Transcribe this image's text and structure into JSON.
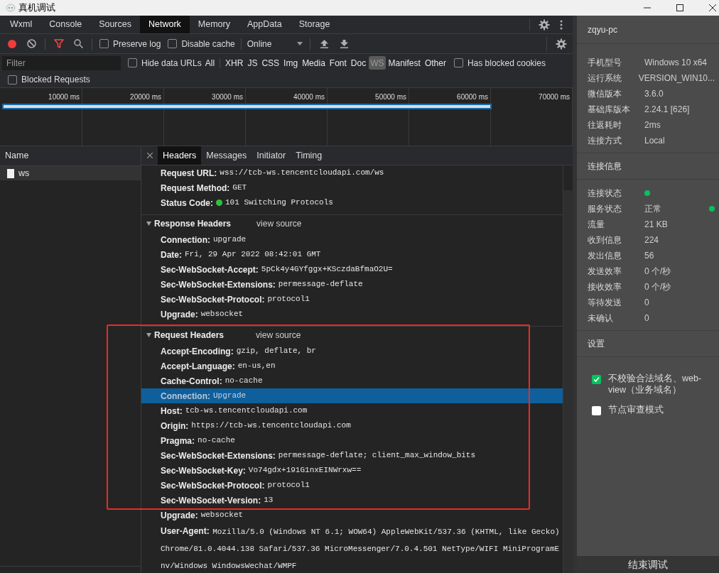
{
  "window": {
    "title": "真机调试"
  },
  "tabs": [
    {
      "label": "Wxml",
      "selected": false
    },
    {
      "label": "Console",
      "selected": false
    },
    {
      "label": "Sources",
      "selected": false
    },
    {
      "label": "Network",
      "selected": true
    },
    {
      "label": "Memory",
      "selected": false
    },
    {
      "label": "AppData",
      "selected": false
    },
    {
      "label": "Storage",
      "selected": false
    }
  ],
  "toolbar": {
    "recording": true,
    "preserve_log": {
      "label": "Preserve log",
      "checked": false
    },
    "disable_cache": {
      "label": "Disable cache",
      "checked": false
    },
    "throttling": "Online"
  },
  "filter": {
    "placeholder": "Filter",
    "hide_data_urls": {
      "label": "Hide data URLs",
      "checked": false
    },
    "types": [
      {
        "label": "All",
        "selected": false
      },
      {
        "label": "XHR",
        "selected": false
      },
      {
        "label": "JS",
        "selected": false
      },
      {
        "label": "CSS",
        "selected": false
      },
      {
        "label": "Img",
        "selected": false
      },
      {
        "label": "Media",
        "selected": false
      },
      {
        "label": "Font",
        "selected": false
      },
      {
        "label": "Doc",
        "selected": false
      },
      {
        "label": "WS",
        "selected": true
      },
      {
        "label": "Manifest",
        "selected": false
      },
      {
        "label": "Other",
        "selected": false
      }
    ],
    "has_blocked_cookies": {
      "label": "Has blocked cookies",
      "checked": false
    },
    "blocked_requests": {
      "label": "Blocked Requests",
      "checked": false
    }
  },
  "timeline": {
    "ticks": [
      "10000 ms",
      "20000 ms",
      "30000 ms",
      "40000 ms",
      "50000 ms",
      "60000 ms",
      "70000 ms"
    ]
  },
  "requests": {
    "header": "Name",
    "items": [
      {
        "name": "ws",
        "selected": true
      }
    ]
  },
  "detail_tabs": [
    {
      "label": "Headers",
      "selected": true
    },
    {
      "label": "Messages",
      "selected": false
    },
    {
      "label": "Initiator",
      "selected": false
    },
    {
      "label": "Timing",
      "selected": false
    }
  ],
  "general": [
    {
      "key": "Request URL:",
      "value": "wss://tcb-ws.tencentcloudapi.com/ws",
      "status_dot": false
    },
    {
      "key": "Request Method:",
      "value": "GET",
      "status_dot": false
    },
    {
      "key": "Status Code:",
      "value": "101 Switching Protocols",
      "status_dot": true
    }
  ],
  "response_headers": {
    "title": "Response Headers",
    "link": "view source",
    "expanded": true,
    "headers": [
      {
        "key": "Connection:",
        "value": "upgrade",
        "selected": false
      },
      {
        "key": "Date:",
        "value": "Fri, 29 Apr 2022 08:42:01 GMT",
        "selected": false
      },
      {
        "key": "Sec-WebSocket-Accept:",
        "value": "5pCk4y4GYfggx+KSczdaBfmaO2U=",
        "selected": false
      },
      {
        "key": "Sec-WebSocket-Extensions:",
        "value": "permessage-deflate",
        "selected": false
      },
      {
        "key": "Sec-WebSocket-Protocol:",
        "value": "protocol1",
        "selected": false
      },
      {
        "key": "Upgrade:",
        "value": "websocket",
        "selected": false
      }
    ]
  },
  "request_headers": {
    "title": "Request Headers",
    "link": "view source",
    "expanded": true,
    "headers": [
      {
        "key": "Accept-Encoding:",
        "value": "gzip, deflate, br",
        "selected": false
      },
      {
        "key": "Accept-Language:",
        "value": "en-us,en",
        "selected": false
      },
      {
        "key": "Cache-Control:",
        "value": "no-cache",
        "selected": false
      },
      {
        "key": "Connection:",
        "value": "Upgrade",
        "selected": true
      },
      {
        "key": "Host:",
        "value": "tcb-ws.tencentcloudapi.com",
        "selected": false
      },
      {
        "key": "Origin:",
        "value": "https://tcb-ws.tencentcloudapi.com",
        "selected": false
      },
      {
        "key": "Pragma:",
        "value": "no-cache",
        "selected": false
      },
      {
        "key": "Sec-WebSocket-Extensions:",
        "value": "permessage-deflate; client_max_window_bits",
        "selected": false
      },
      {
        "key": "Sec-WebSocket-Key:",
        "value": "Vo74gdx+191G1nxEINWrxw==",
        "selected": false
      },
      {
        "key": "Sec-WebSocket-Protocol:",
        "value": "protocol1",
        "selected": false
      },
      {
        "key": "Sec-WebSocket-Version:",
        "value": "13",
        "selected": false
      },
      {
        "key": "Upgrade:",
        "value": "websocket",
        "selected": false
      },
      {
        "key": "User-Agent:",
        "value": "Mozilla/5.0 (Windows NT 6.1; WOW64) AppleWebKit/537.36 (KHTML, like Gecko) Chrome/81.0.4044.138 Safari/537.36 MicroMessenger/7.0.4.501 NetType/WIFI MiniProgramEnv/Windows WindowsWechat/WMPF",
        "selected": false
      }
    ]
  },
  "side_panel": {
    "device_name": "zqyu-pc",
    "device_info": [
      {
        "label": "手机型号",
        "value": "Windows 10 x64"
      },
      {
        "label": "运行系统",
        "value": "VERSION_WIN10..."
      },
      {
        "label": "微信版本",
        "value": "3.6.0"
      },
      {
        "label": "基础库版本",
        "value": "2.24.1 [626]"
      },
      {
        "label": "往返耗时",
        "value": "2ms"
      },
      {
        "label": "连接方式",
        "value": "Local"
      }
    ],
    "connection_title": "连接信息",
    "connection_info": [
      {
        "label": "连接状态",
        "status_dot": true
      },
      {
        "label": "服务状态",
        "value": "正常",
        "status_dot": true
      },
      {
        "label": "流量",
        "value": "21 KB",
        "status_dot": false
      },
      {
        "label": "收到信息",
        "value": "224",
        "status_dot": false
      },
      {
        "label": "发出信息",
        "value": "56",
        "status_dot": false
      },
      {
        "label": "发送效率",
        "value": "0 个/秒",
        "status_dot": false
      },
      {
        "label": "接收效率",
        "value": "0 个/秒",
        "status_dot": false
      },
      {
        "label": "等待发送",
        "value": "0",
        "status_dot": false
      },
      {
        "label": "未确认",
        "value": "0",
        "status_dot": false
      }
    ],
    "settings_title": "设置",
    "settings": [
      {
        "label": "不校验合法域名、web-view（业务域名）",
        "checked": true
      },
      {
        "label": "节点审查模式",
        "checked": false
      }
    ],
    "end_button": "结束调试"
  }
}
